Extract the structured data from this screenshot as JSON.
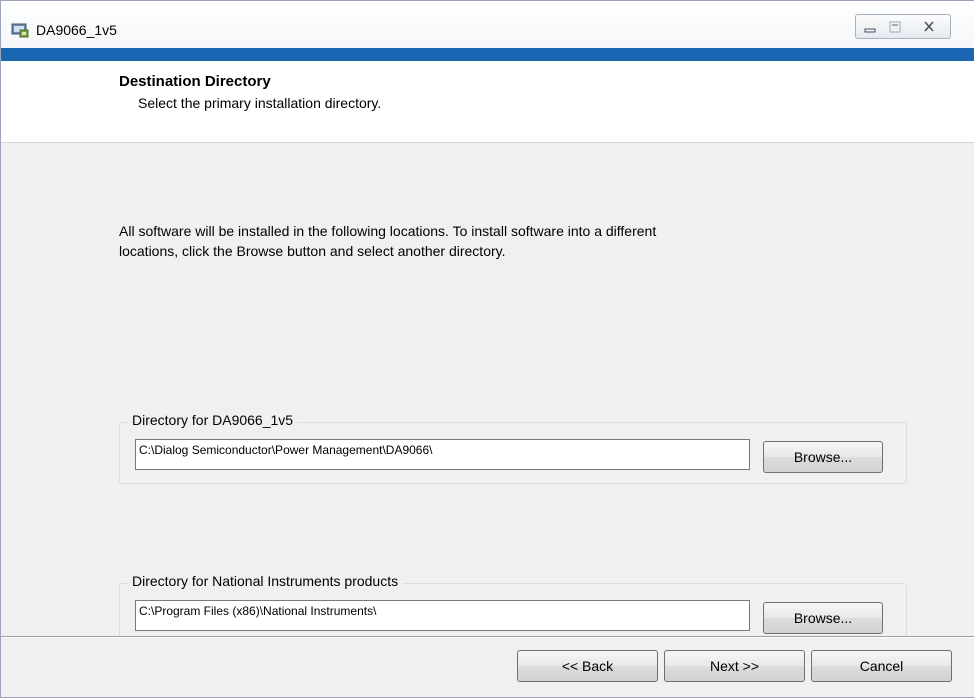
{
  "window": {
    "title": "DA9066_1v5",
    "icon": "installer-icon",
    "controls": [
      "minimize-icon",
      "maximize-icon",
      "close-icon"
    ]
  },
  "colors": {
    "accent_bar": "#1b66b3",
    "dialog_bg": "#f0f0f0",
    "header_bg": "#ffffff"
  },
  "header": {
    "title": "Destination Directory",
    "subtitle": "Select the primary installation directory."
  },
  "body": {
    "line1": "All software will be installed in the following locations. To install software into a different",
    "line2": "locations, click the Browse button and select another directory."
  },
  "groups": [
    {
      "legend": "Directory for DA9066_1v5",
      "path": "C:\\Dialog Semiconductor\\Power Management\\DA9066\\",
      "browse_label": "Browse..."
    },
    {
      "legend": "Directory for National Instruments products",
      "path": "C:\\Program Files (x86)\\National Instruments\\",
      "browse_label": "Browse..."
    }
  ],
  "footer": {
    "back_label": "<< Back",
    "next_label": "Next >>",
    "cancel_label": "Cancel"
  }
}
